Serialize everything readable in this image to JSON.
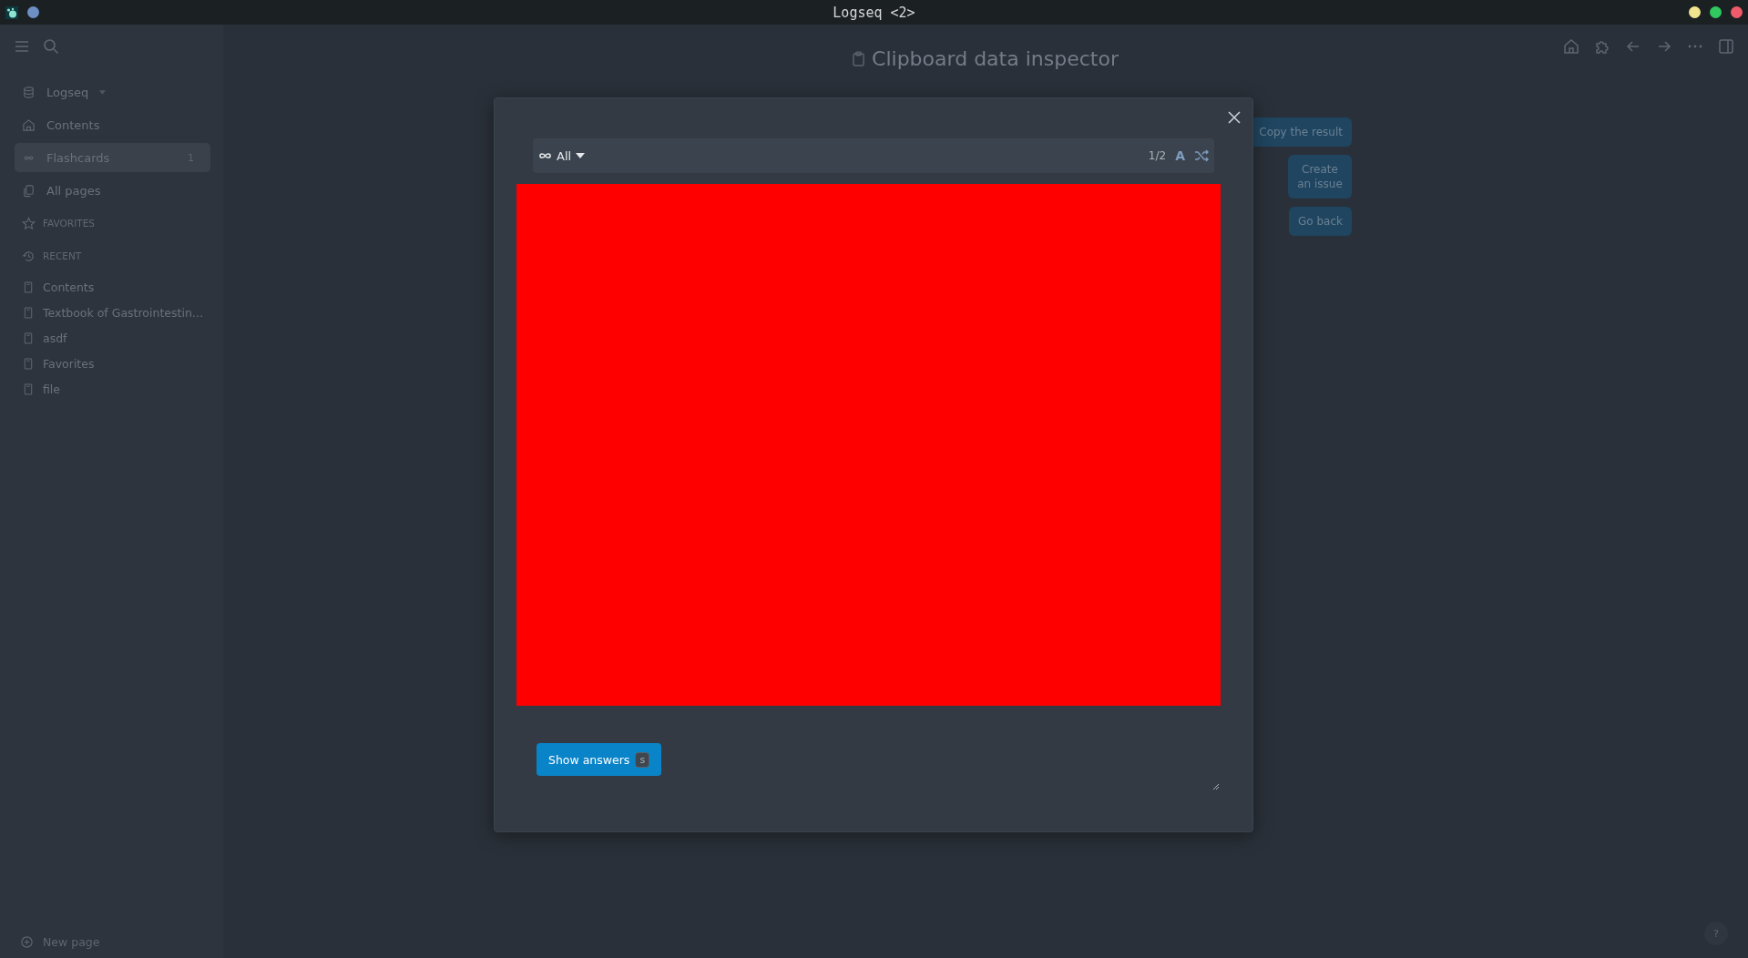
{
  "window": {
    "title": "Logseq <2>"
  },
  "sidebar": {
    "graph": "Logseq",
    "nav": [
      {
        "label": "Contents",
        "selected": false
      },
      {
        "label": "Flashcards",
        "selected": true,
        "count": "1"
      },
      {
        "label": "All pages",
        "selected": false
      }
    ],
    "sections": [
      "FAVORITES",
      "RECENT"
    ],
    "recent": [
      "Contents",
      "Textbook of Gastrointestin…",
      "asdf",
      "Favorites",
      "file"
    ],
    "new_page": "New page"
  },
  "page": {
    "title": "Clipboard data inspector",
    "buttons": [
      "Copy the result",
      "Create an issue",
      "Go back"
    ]
  },
  "modal": {
    "filter": "All",
    "counter": "1/2",
    "font_toggle": "A",
    "show_answers": "Show answers",
    "shortcut": "s"
  },
  "help": "?"
}
